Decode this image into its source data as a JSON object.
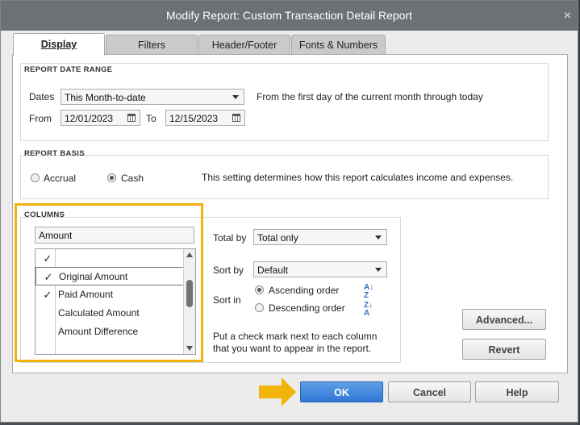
{
  "window": {
    "title": "Modify Report: Custom Transaction Detail Report",
    "close_glyph": "×"
  },
  "tabs": [
    {
      "label": "Display"
    },
    {
      "label": "Filters"
    },
    {
      "label": "Header/Footer"
    },
    {
      "label": "Fonts & Numbers"
    }
  ],
  "date_range": {
    "section_title": "REPORT DATE RANGE",
    "dates_label": "Dates",
    "dates_value": "This Month-to-date",
    "description": "From the first day of the current month through today",
    "from_label": "From",
    "from_value": "12/01/2023",
    "to_label": "To",
    "to_value": "12/15/2023"
  },
  "report_basis": {
    "section_title": "REPORT BASIS",
    "accrual_label": "Accrual",
    "cash_label": "Cash",
    "selected": "Cash",
    "description": "This setting determines how this report calculates income and expenses."
  },
  "columns": {
    "section_title": "COLUMNS",
    "search_value": "Amount",
    "items": [
      {
        "label": "",
        "checked": true,
        "check_glyph": "✓"
      },
      {
        "label": "Original Amount",
        "checked": true,
        "check_glyph": "✓"
      },
      {
        "label": "Paid Amount",
        "checked": true,
        "check_glyph": "✓"
      },
      {
        "label": "Calculated Amount",
        "checked": false,
        "check_glyph": ""
      },
      {
        "label": "Amount Difference",
        "checked": false,
        "check_glyph": ""
      }
    ],
    "selected_item": "Original Amount",
    "total_by_label": "Total by",
    "total_by_value": "Total only",
    "sort_by_label": "Sort by",
    "sort_by_value": "Default",
    "sort_in_label": "Sort in",
    "ascending_label": "Ascending order",
    "descending_label": "Descending order",
    "sort_selected": "Ascending order",
    "hint": "Put a check mark next to each column that you want to appear in the report."
  },
  "buttons": {
    "advanced": "Advanced...",
    "revert": "Revert",
    "ok": "OK",
    "cancel": "Cancel",
    "help": "Help"
  },
  "colors": {
    "highlight": "#f2b30b",
    "primary_button": "#2f77d6",
    "titlebar": "#6d7075"
  },
  "icons": [
    "close-icon",
    "dropdown-arrow-icon",
    "calendar-icon",
    "checkmark-icon",
    "sort-ascending-icon",
    "sort-descending-icon",
    "pointer-arrow-icon"
  ]
}
